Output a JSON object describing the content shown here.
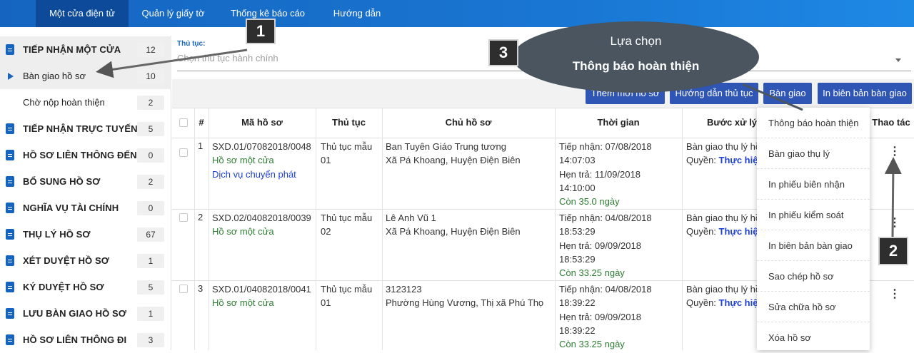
{
  "topnav": {
    "tabs": [
      {
        "label": "Một cửa điện tử"
      },
      {
        "label": "Quản lý giấy tờ"
      },
      {
        "label": "Thống kê báo cáo"
      },
      {
        "label": "Hướng dẫn"
      }
    ]
  },
  "sidebar": {
    "items": [
      {
        "label": "TIẾP NHẬN MỘT CỬA",
        "count": "12"
      },
      {
        "label": "Bàn giao hồ sơ",
        "count": "10"
      },
      {
        "label": "Chờ nộp hoàn thiện",
        "count": "2"
      },
      {
        "label": "TIẾP NHẬN TRỰC TUYẾN",
        "count": "5"
      },
      {
        "label": "HỒ SƠ LIÊN THÔNG ĐẾN",
        "count": "0"
      },
      {
        "label": "BỔ SUNG HỒ SƠ",
        "count": "2"
      },
      {
        "label": "NGHĨA VỤ TÀI CHÍNH",
        "count": "0"
      },
      {
        "label": "THỤ LÝ HỒ SƠ",
        "count": "67"
      },
      {
        "label": "XÉT DUYỆT HỒ SƠ",
        "count": "1"
      },
      {
        "label": "KÝ DUYỆT HỒ SƠ",
        "count": "5"
      },
      {
        "label": "LƯU BÀN GIAO HỒ SƠ",
        "count": "1"
      },
      {
        "label": "HỒ SƠ LIÊN THÔNG ĐI",
        "count": "3"
      }
    ]
  },
  "filter": {
    "label": "Thủ tục:",
    "placeholder": "Chọn thủ tục hành chính"
  },
  "toolbar": {
    "add": "Thêm mới hồ sơ",
    "guide": "Hướng dẫn thủ tục",
    "handover": "Bàn giao",
    "print": "In biên bản bàn giao"
  },
  "table": {
    "headers": {
      "index": "#",
      "code": "Mã hồ sơ",
      "procedure": "Thủ tục",
      "owner": "Chủ hồ sơ",
      "time": "Thời gian",
      "step": "Bước xử lý",
      "actions": "Thao tác"
    },
    "rows": [
      {
        "index": "1",
        "code": "SXD.01/07082018/0048",
        "source": "Hồ sơ một cửa",
        "delivery": "Dịch vụ chuyển phát",
        "procedure_1": "Thủ tục mẫu",
        "procedure_2": "01",
        "owner_1": "Ban Tuyên Giáo Trung tương",
        "owner_2": "Xã Pá Khoang, Huyện Điện Biên",
        "received": "Tiếp nhận: 07/08/2018",
        "received_time": "14:07:03",
        "due": "Hẹn trả: 11/09/2018",
        "due_time": "14:10:00",
        "remaining": "Còn 35.0 ngày",
        "step": "Bàn giao thụ lý hồ",
        "role_label": "Quyền:",
        "role": "Thực hiện"
      },
      {
        "index": "2",
        "code": "SXD.02/04082018/0039",
        "source": "Hồ sơ một cửa",
        "procedure_1": "Thủ tục mẫu",
        "procedure_2": "02",
        "owner_1": "Lê Anh Vũ 1",
        "owner_2": "Xã Pá Khoang, Huyện Điện Biên",
        "received": "Tiếp nhận: 04/08/2018",
        "received_time": "18:53:29",
        "due": "Hẹn trả: 09/09/2018",
        "due_time": "18:53:29",
        "remaining": "Còn 33.25 ngày",
        "step": "Bàn giao thụ lý hồ",
        "role_label": "Quyền:",
        "role": "Thực hiện"
      },
      {
        "index": "3",
        "code": "SXD.01/04082018/0041",
        "source": "Hồ sơ một cửa",
        "procedure_1": "Thủ tục mẫu",
        "procedure_2": "01",
        "owner_1": "3123123",
        "owner_2": "Phường Hùng Vương, Thị xã Phú Thọ",
        "received": "Tiếp nhận: 04/08/2018",
        "received_time": "18:39:22",
        "due": "Hẹn trả: 09/09/2018",
        "due_time": "18:39:22",
        "remaining": "Còn 33.25 ngày",
        "step": "Bàn giao thụ lý hồ",
        "role_label": "Quyền:",
        "role": "Thực hiện"
      }
    ]
  },
  "menu": {
    "items": [
      "Thông báo hoàn thiện",
      "Bàn giao thụ lý",
      "In phiếu biên nhận",
      "In phiếu kiểm soát",
      "In biên bản bàn giao",
      "Sao chép hồ sơ",
      "Sửa chữa hồ sơ",
      "Xóa hồ sơ"
    ]
  },
  "annotations": {
    "callout_1": "1",
    "callout_2": "2",
    "callout_3": "3",
    "bubble_line1": "Lựa chọn",
    "bubble_line2": "Thông báo hoàn thiện"
  },
  "colors": {
    "nav": "#1976d2",
    "button": "#2f55b5",
    "accent": "#1565c0",
    "callout": "#2e2e2e",
    "bubble": "#4a5560"
  }
}
